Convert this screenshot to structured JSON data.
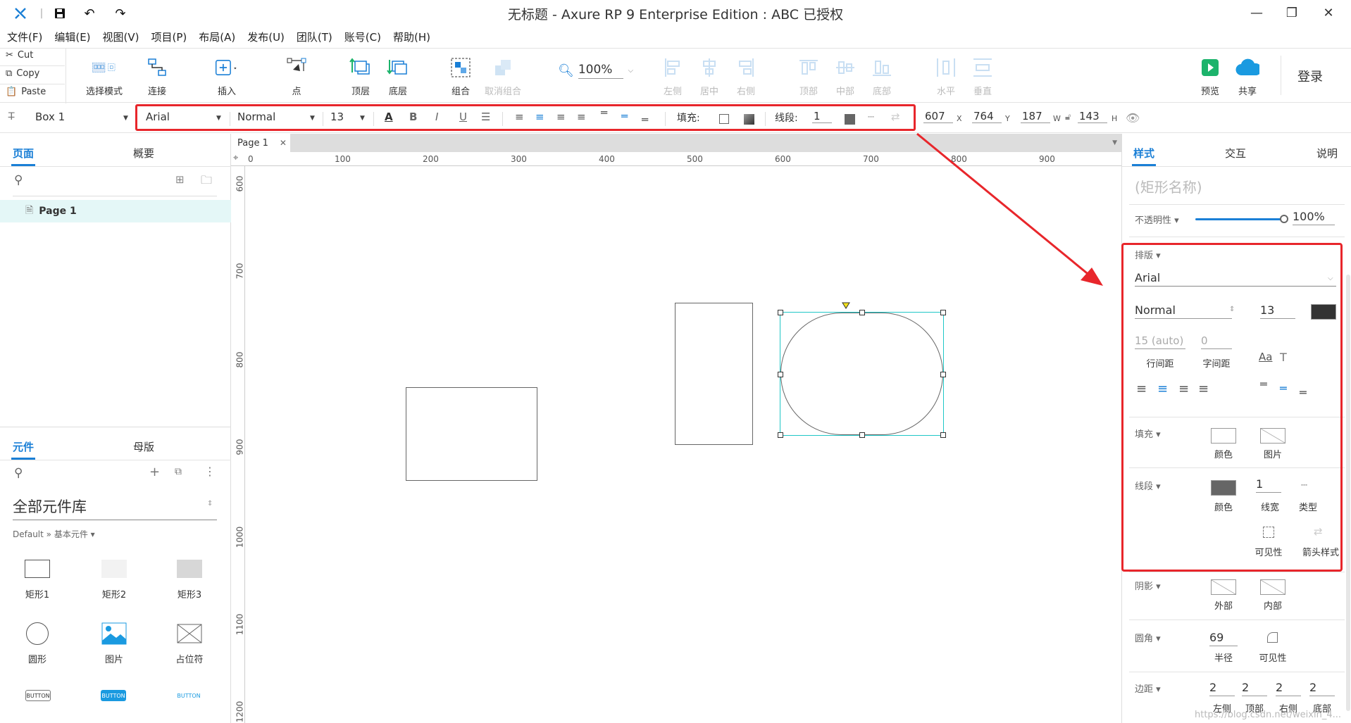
{
  "window": {
    "title": "无标题 - Axure RP 9 Enterprise Edition : ABC 已授权"
  },
  "menu": [
    "文件(F)",
    "编辑(E)",
    "视图(V)",
    "项目(P)",
    "布局(A)",
    "发布(U)",
    "团队(T)",
    "账号(C)",
    "帮助(H)"
  ],
  "clipboard": {
    "cut": "Cut",
    "copy": "Copy",
    "paste": "Paste"
  },
  "toolbar": {
    "select_mode": "选择模式",
    "connect": "连接",
    "insert": "插入",
    "point": "点",
    "top_layer": "顶层",
    "bottom_layer": "底层",
    "group": "组合",
    "ungroup": "取消组合",
    "zoom": "100%",
    "align_left": "左侧",
    "align_center": "居中",
    "align_right": "右侧",
    "align_top": "顶部",
    "align_middle": "中部",
    "align_bottom": "底部",
    "distribute_h": "水平",
    "distribute_v": "垂直",
    "preview": "预览",
    "share": "共享",
    "login": "登录"
  },
  "styletoolbar": {
    "widget_name": "Box 1",
    "font": "Arial",
    "font_weight": "Normal",
    "font_size": "13",
    "fill_label": "填充:",
    "stroke_label": "线段:",
    "stroke_width": "1",
    "x": "607",
    "y": "764",
    "w": "187",
    "h": "143",
    "x_unit": "X",
    "y_unit": "Y",
    "w_unit": "W",
    "h_unit": "H"
  },
  "pages_panel": {
    "tab_pages": "页面",
    "tab_outline": "概要",
    "page_item": "Page 1"
  },
  "library_panel": {
    "tab_widgets": "元件",
    "tab_masters": "母版",
    "library_name": "全部元件库",
    "breadcrumb": "Default » 基本元件 ▾",
    "widgets": [
      "矩形1",
      "矩形2",
      "矩形3",
      "圆形",
      "图片",
      "占位符"
    ],
    "button_text": "BUTTON"
  },
  "canvas": {
    "doc_tab": "Page 1",
    "ruler_h": [
      "0",
      "100",
      "200",
      "300",
      "400",
      "500",
      "600",
      "700",
      "800",
      "900"
    ],
    "ruler_v": [
      "600",
      "700",
      "800",
      "900",
      "1000",
      "1100",
      "1200"
    ]
  },
  "right_panel": {
    "tab_style": "样式",
    "tab_interact": "交互",
    "tab_notes": "说明",
    "shape_name_placeholder": "(矩形名称)",
    "opacity_label": "不透明性 ▾",
    "opacity_value": "100%",
    "typography_label": "排版 ▾",
    "font": "Arial",
    "font_weight": "Normal",
    "font_size": "13",
    "line_height": "15 (auto)",
    "letter_spacing": "0",
    "line_height_label": "行间距",
    "letter_spacing_label": "字间距",
    "fill_label": "填充 ▾",
    "fill_color": "颜色",
    "fill_image": "图片",
    "stroke_label": "线段 ▾",
    "stroke_color": "颜色",
    "stroke_width": "1",
    "stroke_width_label": "线宽",
    "stroke_type": "类型",
    "visibility": "可见性",
    "arrow_style": "箭头样式",
    "shadow_label": "阴影 ▾",
    "shadow_outer": "外部",
    "shadow_inner": "内部",
    "corner_label": "圆角 ▾",
    "corner_radius": "69",
    "corner_radius_label": "半径",
    "corner_visibility": "可见性",
    "padding_label": "边距 ▾",
    "padding_left": "2",
    "padding_top": "2",
    "padding_right": "2",
    "padding_bottom": "2",
    "padding_left_label": "左侧",
    "padding_top_label": "顶部",
    "padding_right_label": "右侧",
    "padding_bottom_label": "底部"
  },
  "colors": {
    "accent": "#1a7fd6",
    "highlight_red": "#e8262b",
    "selection": "#1fc7c7",
    "preview_green": "#1cb36b"
  },
  "watermark": "https://blog.csdn.net/weixin_4..."
}
